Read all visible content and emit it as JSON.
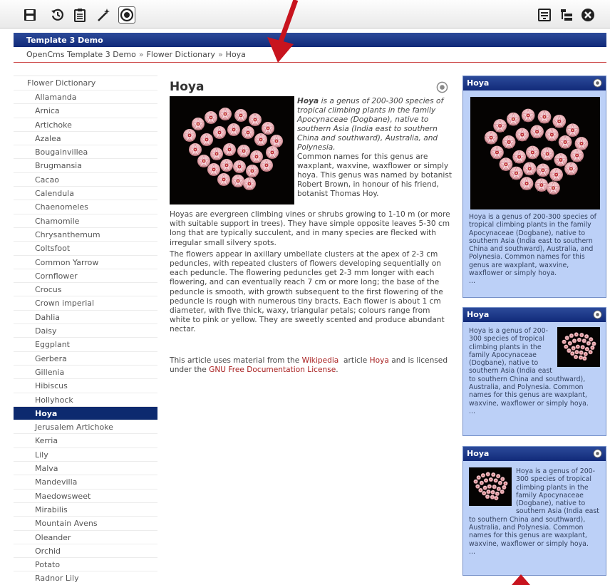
{
  "toolbar": {
    "left_icons": [
      "save-icon",
      "history-icon",
      "clipboard-icon",
      "magic-wand-icon",
      "target-icon"
    ],
    "right_icons": [
      "list-icon",
      "tree-icon",
      "close-icon"
    ]
  },
  "header": {
    "title": "Template 3 Demo"
  },
  "breadcrumb": {
    "items": [
      "OpenCms Template 3 Demo",
      "Flower Dictionary",
      "Hoya"
    ],
    "separator": "»"
  },
  "nav": {
    "title": "Flower Dictionary",
    "active": "Hoya",
    "items": [
      "Allamanda",
      "Arnica",
      "Artichoke",
      "Azalea",
      "Bougainvillea",
      "Brugmansia",
      "Cacao",
      "Calendula",
      "Chaenomeles",
      "Chamomile",
      "Chrysanthemum",
      "Coltsfoot",
      "Common Yarrow",
      "Cornflower",
      "Crocus",
      "Crown imperial",
      "Dahlia",
      "Daisy",
      "Eggplant",
      "Gerbera",
      "Gillenia",
      "Hibiscus",
      "Hollyhock",
      "Hoya",
      "Jerusalem Artichoke",
      "Kerria",
      "Lily",
      "Malva",
      "Mandevilla",
      "Maedowsweet",
      "Mirabilis",
      "Mountain Avens",
      "Oleander",
      "Orchid",
      "Potato",
      "Radnor Lily"
    ]
  },
  "article": {
    "title": "Hoya",
    "intro_bold": "Hoya",
    "intro_italic": " is a genus of 200-300 species of tropical climbing plants in the family Apocynaceae (Dogbane), native to southern Asia (India east to southern China and southward), Australia, and Polynesia.",
    "intro_rest": "Common names for this genus are waxplant, waxvine, waxflower or simply hoya. This genus was named by botanist Robert Brown, in honour of his friend, botanist Thomas Hoy.",
    "para1": "Hoyas are evergreen climbing vines or shrubs growing to 1-10 m (or more with suitable support in trees). They have simple opposite leaves 5-30 cm long that are typically succulent, and in many species are flecked with irregular small silvery spots.",
    "para2": "The flowers appear in axillary umbellate clusters at the apex of 2-3 cm peduncles, with repeated clusters of flowers developing sequentially on each peduncle. The flowering peduncles get 2-3 mm longer with each flowering, and can eventually reach 7 cm or more long; the base of the peduncle is smooth, with growth subsequent to the first flowering of the peduncle is rough with numerous tiny bracts. Each flower is about 1 cm diameter, with five thick, waxy, triangular petals; colours range from white to pink or yellow. They are sweetly scented and produce abundant nectar.",
    "license_1": "This article uses material from the ",
    "license_link1": "Wikipedia",
    "license_2": "  article ",
    "license_link2": "Hoya",
    "license_3": " and is licensed under the ",
    "license_link3": "GNU Free Documentation License",
    "license_4": "."
  },
  "boxes": [
    {
      "title": "Hoya",
      "text": "Hoya is a genus of 200-300 species of tropical climbing plants in the family Apocynaceae (Dogbane), native to southern Asia (India east to southern China and southward), Australia, and Polynesia. Common names for this genus are waxplant, waxvine, waxflower or simply hoya.",
      "more": "..."
    },
    {
      "title": "Hoya",
      "text": "Hoya is a genus of 200-300 species of tropical climbing plants in the family Apocynaceae (Dogbane), native to southern Asia (India east to southern China and southward), Australia, and Polynesia. Common names for this genus are waxplant, waxvine, waxflower or simply hoya.",
      "more": "..."
    },
    {
      "title": "Hoya",
      "text": "Hoya is a genus of 200-300 species of tropical climbing plants in the family Apocynaceae (Dogbane), native to southern Asia (India east to southern China and southward), Australia, and Polynesia. Common names for this genus are waxplant, waxvine, waxflower or simply hoya.",
      "more": "..."
    }
  ],
  "colors": {
    "header_blue": "#112a79",
    "box_bg": "#bcd0f7",
    "link_red": "#a81f1f",
    "annotation_red": "#c8141e"
  }
}
